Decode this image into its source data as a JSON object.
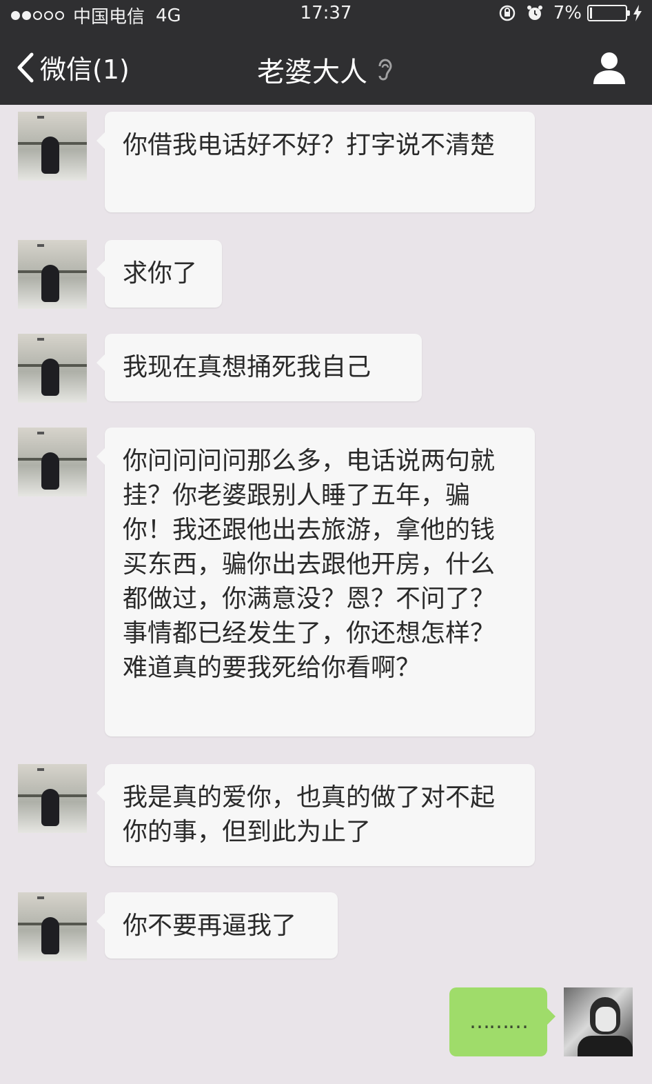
{
  "status_bar": {
    "carrier": "中国电信",
    "network": "4G",
    "time": "17:37",
    "battery": "7%",
    "signal_bars_filled": 2,
    "signal_bars_total": 5
  },
  "nav": {
    "back_label": "微信(1)",
    "title": "老婆大人"
  },
  "messages": [
    {
      "from": "other",
      "text": "你借我电话好不好？打字说不清楚"
    },
    {
      "from": "other",
      "text": "求你了"
    },
    {
      "from": "other",
      "text": "我现在真想捅死我自己"
    },
    {
      "from": "other",
      "text": "你问问问问那么多，电话说两句就挂？你老婆跟别人睡了五年，骗你！我还跟他出去旅游，拿他的钱买东西，骗你出去跟他开房，什么都做过，你满意没？恩？不问了？事情都已经发生了，你还想怎样？难道真的要我死给你看啊？"
    },
    {
      "from": "other",
      "text": "我是真的爱你，也真的做了对不起你的事，但到此为止了"
    },
    {
      "from": "other",
      "text": "你不要再逼我了"
    },
    {
      "from": "me",
      "text": "………"
    }
  ],
  "colors": {
    "bar_background": "#2f2f31",
    "chat_background": "#e9e4e9",
    "incoming_bubble": "#f7f7f7",
    "outgoing_bubble": "#9fdc6a"
  }
}
